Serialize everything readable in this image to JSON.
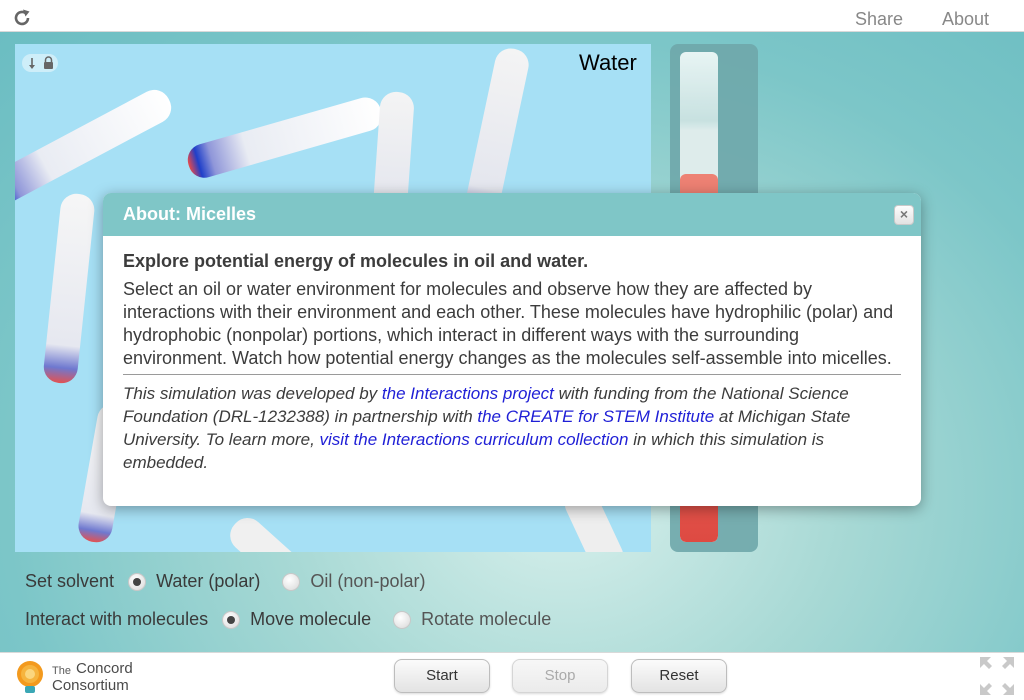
{
  "topbar": {
    "share_label": "Share",
    "about_label": "About",
    "reload_icon": "reload-icon"
  },
  "simulation": {
    "viewport_label": "Water",
    "thermometer_level": 0.75,
    "solvent": {
      "label": "Set solvent",
      "options": [
        {
          "label": "Water (polar)",
          "selected": true
        },
        {
          "label": "Oil (non-polar)",
          "selected": false
        }
      ]
    },
    "interact": {
      "label": "Interact with molecules",
      "options": [
        {
          "label": "Move molecule",
          "selected": true
        },
        {
          "label": "Rotate molecule",
          "selected": false
        }
      ]
    }
  },
  "footer": {
    "logo_line1": "The",
    "logo_line2": "Concord",
    "logo_line3": "Consortium",
    "start_label": "Start",
    "stop_label": "Stop",
    "reset_label": "Reset",
    "fullscreen_icon": "fullscreen-icon"
  },
  "about_dialog": {
    "title": "About: Micelles",
    "close_label": "×",
    "heading": "Explore potential energy of molecules in oil and water.",
    "body": "Select an oil or water environment for molecules and observe how they are affected by interactions with their environment and each other. These molecules have hydrophilic (polar) and hydrophobic (nonpolar) portions, which interact in different ways with the surrounding environment. Watch how potential energy changes as the molecules self-assemble into micelles.",
    "credit": {
      "t1": "This simulation was developed by ",
      "link1": "the Interactions project",
      "t2": " with funding from the National Science Foundation (DRL-1232388) in partnership with ",
      "link2": "the CREATE for STEM Institute",
      "t3": " at Michigan State University. To learn more, ",
      "link3": "visit the Interactions curriculum collection",
      "t4": " in which this simulation is embedded."
    }
  },
  "colors": {
    "dialog_header": "#7fc6c7",
    "link": "#1f1fd6",
    "viewport_bg": "#a6e0f5",
    "thermometer_fill": "#e23a32"
  }
}
